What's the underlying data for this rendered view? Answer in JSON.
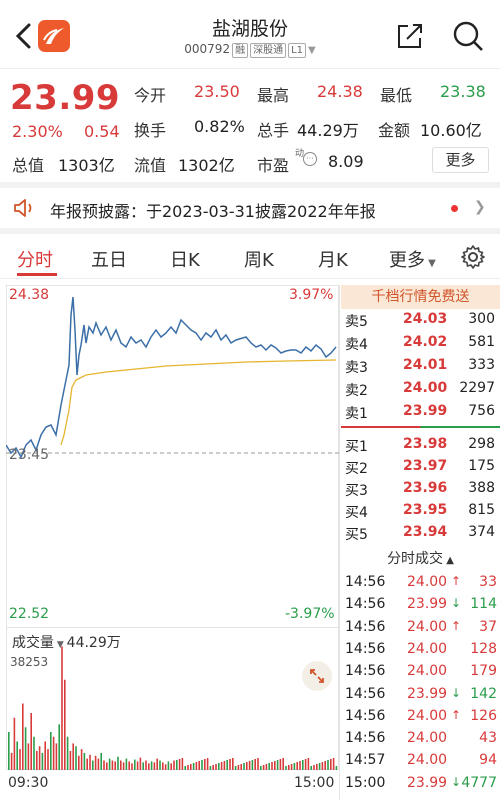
{
  "header": {
    "title": "盐湖股份",
    "code": "000792",
    "tags": [
      "融",
      "深股通",
      "L1"
    ]
  },
  "quote": {
    "price": "23.99",
    "change_pct": "2.30%",
    "change_amt": "0.54",
    "rows": [
      [
        {
          "k": "今开",
          "v": "23.50",
          "c": "red"
        },
        {
          "k": "最高",
          "v": "24.38",
          "c": "red"
        },
        {
          "k": "最低",
          "v": "23.38",
          "c": "green"
        }
      ],
      [
        {
          "k": "换手",
          "v": "0.82%",
          "c": "black"
        },
        {
          "k": "总手",
          "v": "44.29万",
          "c": "black"
        },
        {
          "k": "金额",
          "v": "10.60亿",
          "c": "black"
        }
      ],
      [
        {
          "k": "总值",
          "v": "1303亿",
          "c": "black"
        },
        {
          "k": "流值",
          "v": "1302亿",
          "c": "black"
        },
        {
          "k": "市盈",
          "v": "8.09",
          "c": "black",
          "sup": "动"
        }
      ]
    ],
    "more_label": "更多"
  },
  "notice": {
    "text": "年报预披露：于2023-03-31披露2022年年报"
  },
  "tabs": [
    "分时",
    "五日",
    "日K",
    "周K",
    "月K",
    "更多"
  ],
  "chart": {
    "top_price": "24.38",
    "bottom_price": "22.52",
    "top_pct": "3.97%",
    "bottom_pct": "-3.97%",
    "mid_price": "23.45",
    "start_time": "09:30",
    "end_time": "15:00"
  },
  "volume": {
    "label": "成交量",
    "total": "44.29万",
    "max": "38253"
  },
  "order_book": {
    "header": "千档行情免费送",
    "asks": [
      {
        "label": "卖5",
        "price": "24.03",
        "vol": "300"
      },
      {
        "label": "卖4",
        "price": "24.02",
        "vol": "581"
      },
      {
        "label": "卖3",
        "price": "24.01",
        "vol": "333"
      },
      {
        "label": "卖2",
        "price": "24.00",
        "vol": "2297"
      },
      {
        "label": "卖1",
        "price": "23.99",
        "vol": "756"
      }
    ],
    "bids": [
      {
        "label": "买1",
        "price": "23.98",
        "vol": "298"
      },
      {
        "label": "买2",
        "price": "23.97",
        "vol": "175"
      },
      {
        "label": "买3",
        "price": "23.96",
        "vol": "388"
      },
      {
        "label": "买4",
        "price": "23.95",
        "vol": "815"
      },
      {
        "label": "买5",
        "price": "23.94",
        "vol": "374"
      }
    ]
  },
  "ticks": {
    "header": "分时成交",
    "rows": [
      {
        "time": "14:56",
        "price": "24.00",
        "dir": "up",
        "vol": "33"
      },
      {
        "time": "14:56",
        "price": "23.99",
        "dir": "down",
        "vol": "114"
      },
      {
        "time": "14:56",
        "price": "24.00",
        "dir": "up",
        "vol": "37"
      },
      {
        "time": "14:56",
        "price": "24.00",
        "dir": "",
        "vol": "128"
      },
      {
        "time": "14:56",
        "price": "24.00",
        "dir": "",
        "vol": "179"
      },
      {
        "time": "14:56",
        "price": "23.99",
        "dir": "down",
        "vol": "142"
      },
      {
        "time": "14:56",
        "price": "24.00",
        "dir": "up",
        "vol": "126"
      },
      {
        "time": "14:56",
        "price": "24.00",
        "dir": "",
        "vol": "43"
      },
      {
        "time": "14:57",
        "price": "24.00",
        "dir": "",
        "vol": "94"
      },
      {
        "time": "15:00",
        "price": "23.99",
        "dir": "down",
        "vol": "4777"
      }
    ]
  },
  "colors": {
    "up": "#d83a3a",
    "down": "#2a9d4b",
    "price_line": "#3b6fa8",
    "avg_line": "#e6b42f"
  }
}
